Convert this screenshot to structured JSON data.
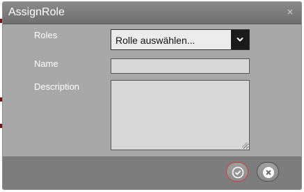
{
  "dialog": {
    "title": "AssignRole",
    "close_glyph": "×"
  },
  "form": {
    "roles_label": "Roles",
    "roles_selected": "Rolle auswählen...",
    "name_label": "Name",
    "name_value": "",
    "description_label": "Description",
    "description_value": ""
  },
  "footer": {
    "confirm_icon": "check-circle-icon",
    "cancel_icon": "x-circle-icon"
  },
  "colors": {
    "dialog_body": "#a8a8a8",
    "titlebar": "#7a7a7a",
    "footer": "#7d7d7d",
    "confirm_border": "#d33a3a"
  }
}
